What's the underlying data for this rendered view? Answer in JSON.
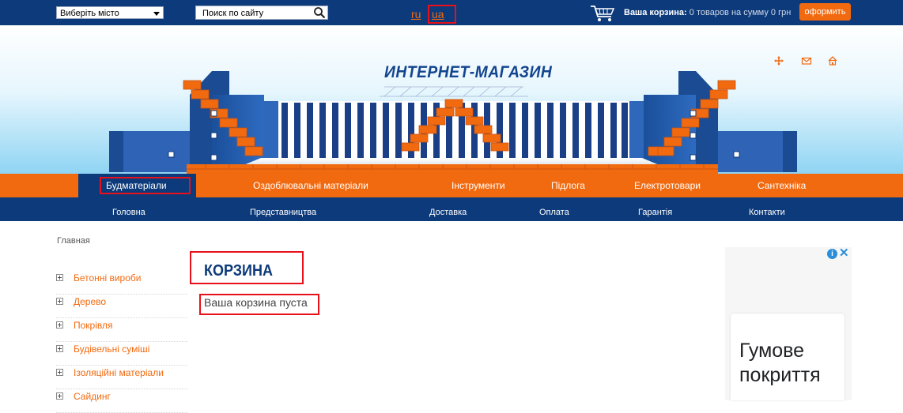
{
  "top_bar": {
    "city_select": "Виберіть місто",
    "search_placeholder": "Поиск по сайту",
    "lang_ru": "ru",
    "lang_ua": "ua",
    "cart_label": "Ваша корзина:",
    "cart_summary": "0 товаров на сумму 0 грн",
    "checkout_button": "оформить"
  },
  "banner": {
    "shop_title": "ИНТЕРНЕТ-МАГАЗИН",
    "icons": [
      "move-icon",
      "mail-icon",
      "home-icon"
    ]
  },
  "category_nav": [
    "Будматеріали",
    "Оздоблювальні матеріали",
    "Інструменти",
    "Підлога",
    "Електротовари",
    "Сантехніка"
  ],
  "info_nav": [
    "Головна",
    "Представництва",
    "Доставка",
    "Оплата",
    "Гарантія",
    "Контакти"
  ],
  "breadcrumb": "Главная",
  "sidebar": [
    "Бетонні вироби",
    "Дерево",
    "Покрівля",
    "Будівельні суміші",
    "Ізоляційні матеріали",
    "Сайдинг"
  ],
  "main": {
    "heading": "КОРЗИНА",
    "empty_message": "Ваша корзина пуста"
  },
  "ad": {
    "text": "Гумове покриття"
  },
  "colors": {
    "navy": "#0d3a7a",
    "orange": "#f26a10",
    "highlight_red": "#e8101a"
  }
}
